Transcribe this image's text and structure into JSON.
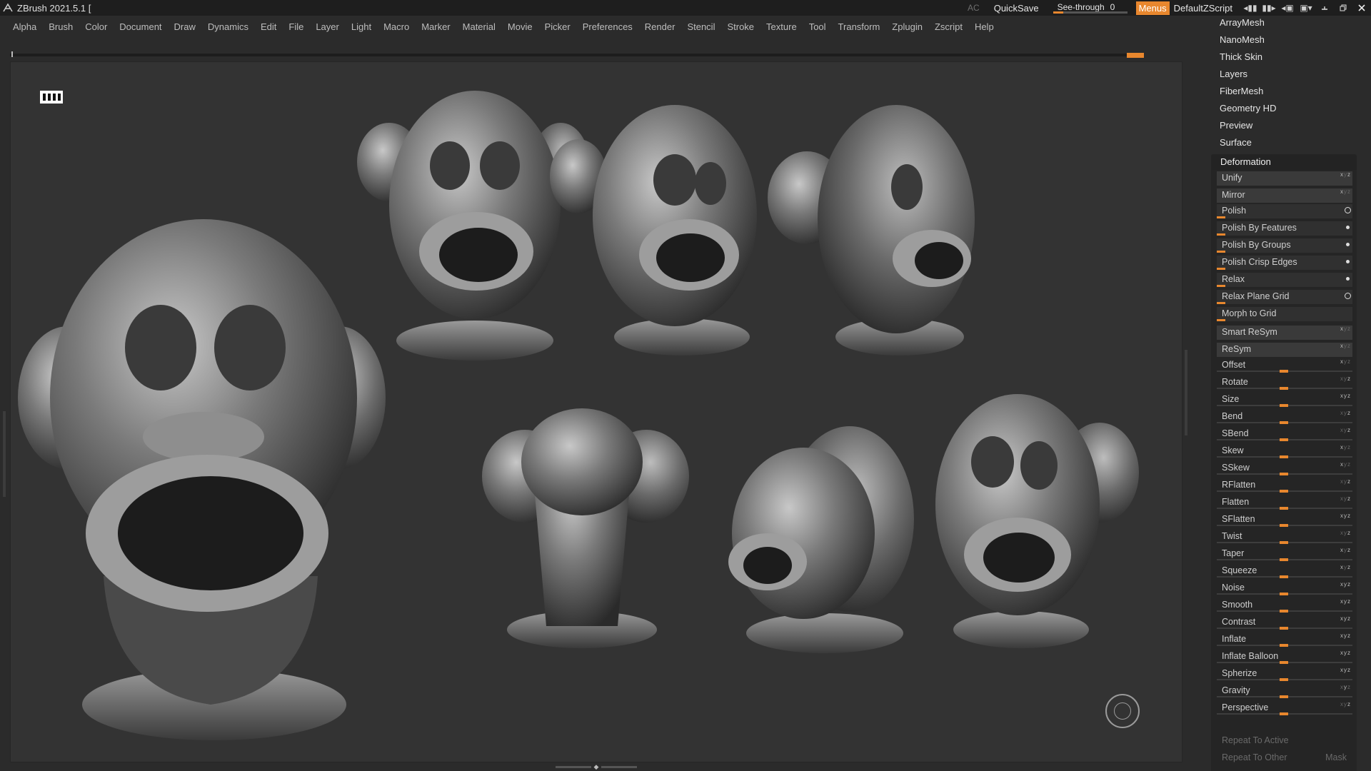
{
  "titlebar": {
    "title": "ZBrush 2021.5.1 [",
    "ac": "AC",
    "quicksave": "QuickSave",
    "see_through_label": "See-through",
    "see_through_value": "0",
    "menus": "Menus",
    "script": "DefaultZScript"
  },
  "menubar": {
    "items": [
      "Alpha",
      "Brush",
      "Color",
      "Document",
      "Draw",
      "Dynamics",
      "Edit",
      "File",
      "Layer",
      "Light",
      "Macro",
      "Marker",
      "Material",
      "Movie",
      "Picker",
      "Preferences",
      "Render",
      "Stencil",
      "Stroke",
      "Texture",
      "Tool",
      "Transform",
      "Zplugin",
      "Zscript",
      "Help"
    ]
  },
  "panel": {
    "subpalettes": [
      "ArrayMesh",
      "NanoMesh",
      "Thick Skin",
      "Layers",
      "FiberMesh",
      "Geometry HD",
      "Preview",
      "Surface"
    ],
    "deformation": {
      "header": "Deformation",
      "unify": "Unify",
      "mirror": "Mirror",
      "polish": "Polish",
      "polish_by_features": "Polish By Features",
      "polish_by_groups": "Polish By Groups",
      "polish_crisp_edges": "Polish Crisp Edges",
      "relax": "Relax",
      "relax_plane_grid": "Relax Plane Grid",
      "morph_to_grid": "Morph to Grid",
      "smart_resym": "Smart ReSym",
      "resym": "ReSym",
      "sliders": [
        "Offset",
        "Rotate",
        "Size",
        "Bend",
        "SBend",
        "Skew",
        "SSkew",
        "RFlatten",
        "Flatten",
        "SFlatten",
        "Twist",
        "Taper",
        "Squeeze",
        "Noise",
        "Smooth",
        "Contrast",
        "Inflate",
        "Inflate Balloon",
        "Spherize",
        "Gravity",
        "Perspective"
      ],
      "repeat_to_active": "Repeat To Active",
      "repeat_to_other": "Repeat To Other",
      "mask": "Mask"
    }
  },
  "accent_color": "#e8872e"
}
